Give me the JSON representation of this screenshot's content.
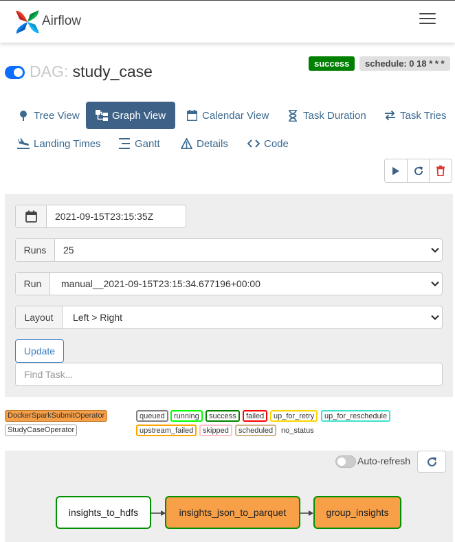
{
  "header": {
    "brand": "Airflow"
  },
  "dag": {
    "label": "DAG:",
    "name": "study_case",
    "status_badge": "success",
    "schedule_badge": "schedule: 0 18 * * *"
  },
  "nav": {
    "tree": "Tree View",
    "graph": "Graph View",
    "calendar": "Calendar View",
    "duration": "Task Duration",
    "tries": "Task Tries",
    "landing": "Landing Times",
    "gantt": "Gantt",
    "details": "Details",
    "code": "Code"
  },
  "form": {
    "date": "2021-09-15T23:15:35Z",
    "runs_label": "Runs",
    "runs_value": "25",
    "run_label": "Run",
    "run_value": "manual__2021-09-15T23:15:34.677196+00:00",
    "layout_label": "Layout",
    "layout_value": "Left > Right",
    "update": "Update",
    "find_placeholder": "Find Task..."
  },
  "operators": [
    {
      "name": "DockerSparkSubmitOperator",
      "color": "#f7a048"
    },
    {
      "name": "StudyCaseOperator",
      "color": "#ffffff"
    }
  ],
  "states": {
    "queued": "queued",
    "running": "running",
    "success": "success",
    "failed": "failed",
    "up_for_retry": "up_for_retry",
    "up_for_reschedule": "up_for_reschedule",
    "upstream_failed": "upstream_failed",
    "skipped": "skipped",
    "scheduled": "scheduled",
    "no_status": "no_status"
  },
  "graph": {
    "auto_refresh": "Auto-refresh",
    "nodes": [
      "insights_to_hdfs",
      "insights_json_to_parquet",
      "group_insights"
    ]
  },
  "colors": {
    "success": "#008000",
    "nav_active": "#3e6287",
    "link": "#3b6a91",
    "operator_docker": "#f7a048"
  }
}
